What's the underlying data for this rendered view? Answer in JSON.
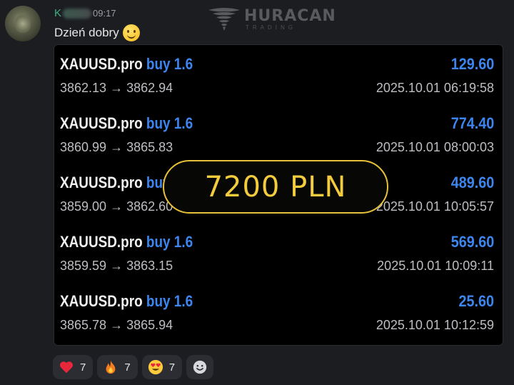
{
  "message": {
    "sender": "K",
    "time": "09:17",
    "text": "Dzień dobry"
  },
  "logo": {
    "name": "HURACAN",
    "subtitle": "TRADING"
  },
  "trades": [
    {
      "symbol": "XAUUSD.pro",
      "side": "buy 1.6",
      "profit": "129.60",
      "prices": "3862.13 → 3862.94",
      "datetime": "2025.10.01 06:19:58"
    },
    {
      "symbol": "XAUUSD.pro",
      "side": "buy 1.6",
      "profit": "774.40",
      "prices": "3860.99 → 3865.83",
      "datetime": "2025.10.01 08:00:03"
    },
    {
      "symbol": "XAUUSD.pro",
      "side": "buy 1.6",
      "profit": "489.60",
      "prices": "3859.00 → 3862.60",
      "datetime": "2025.10.01 10:05:57"
    },
    {
      "symbol": "XAUUSD.pro",
      "side": "buy 1.6",
      "profit": "569.60",
      "prices": "3859.59 → 3863.15",
      "datetime": "2025.10.01 10:09:11"
    },
    {
      "symbol": "XAUUSD.pro",
      "side": "buy 1.6",
      "profit": "25.60",
      "prices": "3865.78 → 3865.94",
      "datetime": "2025.10.01 10:12:59"
    }
  ],
  "overlay": {
    "text": "7200 PLN"
  },
  "reactions": [
    {
      "icon": "heart-icon",
      "count": "7"
    },
    {
      "icon": "fire-icon",
      "count": "7"
    },
    {
      "icon": "heart-eyes-icon",
      "count": "7"
    }
  ],
  "colors": {
    "accent_blue": "#3d86f0",
    "gold": "#f2cc3d",
    "sender_green": "#3fb27f"
  }
}
